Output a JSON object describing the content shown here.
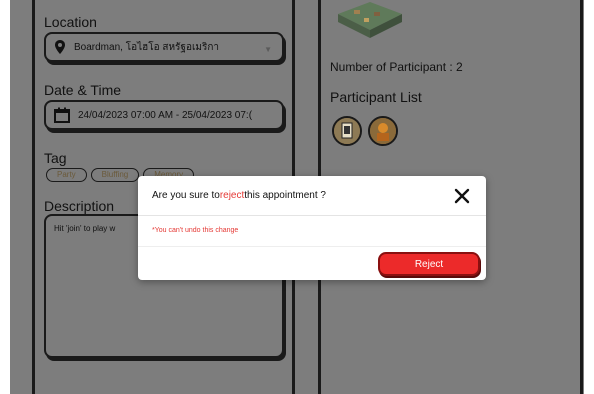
{
  "form": {
    "location_label": "Location",
    "location_value": "Boardman, โอไฮโอ สหรัฐอเมริกา",
    "datetime_label": "Date & Time",
    "datetime_value": "24/04/2023 07:00 AM - 25/04/2023 07:(",
    "tag_label": "Tag",
    "tags": [
      "Party",
      "Bluffing",
      "Memory"
    ],
    "description_label": "Description",
    "description_value": "Hit 'join' to play w"
  },
  "detail": {
    "participant_count": "Number of Participant : 2",
    "participant_list_label": "Participant List"
  },
  "modal": {
    "title_prefix": "Are you sure to ",
    "title_action": "reject",
    "title_suffix": " this appointment ?",
    "warning": "*You can't undo this change",
    "reject_label": "Reject"
  },
  "icons": {
    "location": "location-pin-icon",
    "calendar": "calendar-icon",
    "dropdown": "chevron-down-icon",
    "close": "close-icon"
  },
  "colors": {
    "accent": "#e53935",
    "reject_button": "#ec2a2a",
    "overlay": "#7d7d7d"
  }
}
